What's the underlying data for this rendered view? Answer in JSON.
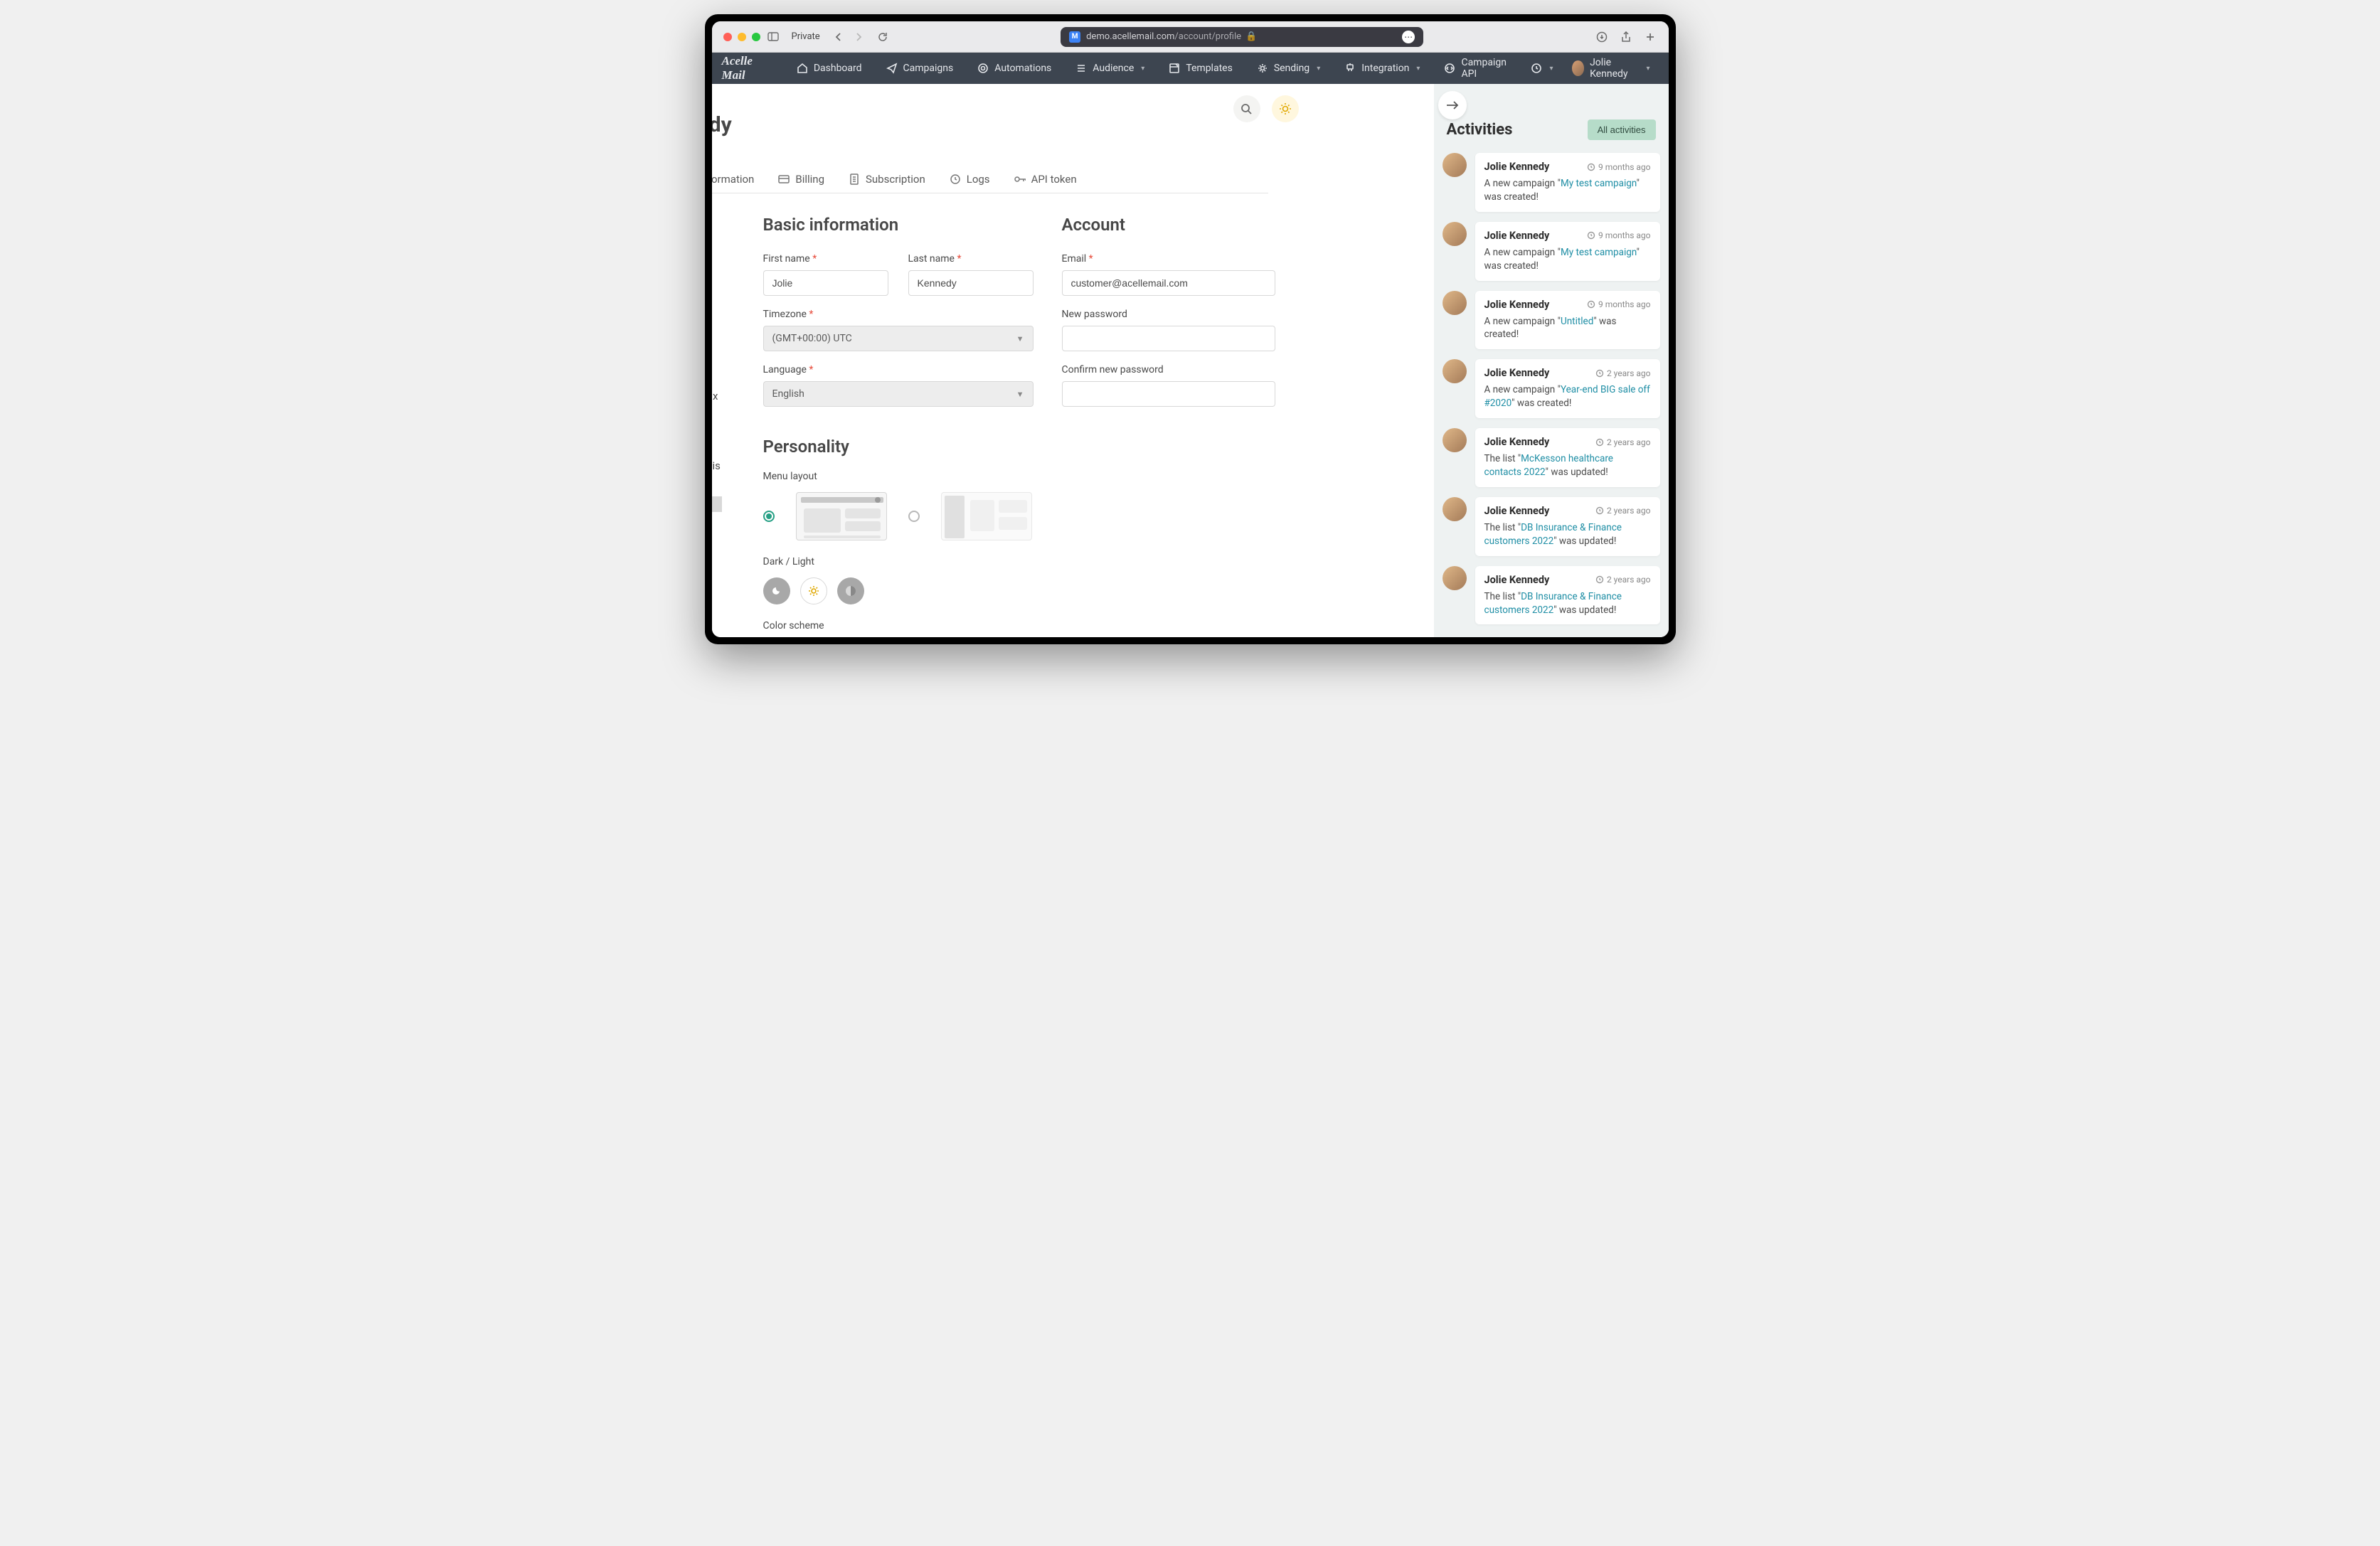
{
  "browser": {
    "private_label": "Private",
    "url_host": "demo.acellemail.com",
    "url_path": "/account/profile"
  },
  "brand": "Acelle Mail",
  "nav": {
    "dashboard": "Dashboard",
    "campaigns": "Campaigns",
    "automations": "Automations",
    "audience": "Audience",
    "templates": "Templates",
    "sending": "Sending",
    "integration": "Integration",
    "api": "Campaign API",
    "user": "Jolie Kennedy"
  },
  "page_title_fragment": "edy",
  "tabs": {
    "info": "nformation",
    "billing": "Billing",
    "subscription": "Subscription",
    "logs": "Logs",
    "apitoken": "API token"
  },
  "left_fragments": {
    "px": "px x",
    "ze": "ze is"
  },
  "sections": {
    "basic": "Basic information",
    "account": "Account",
    "personality": "Personality"
  },
  "fields": {
    "firstname_label": "First name ",
    "firstname_value": "Jolie",
    "lastname_label": "Last name ",
    "lastname_value": "Kennedy",
    "timezone_label": "Timezone ",
    "timezone_value": "(GMT+00:00) UTC",
    "language_label": "Language ",
    "language_value": "English",
    "email_label": "Email ",
    "email_value": "customer@acellemail.com",
    "newpass_label": "New password",
    "confirmpass_label": "Confirm new password",
    "menulayout_label": "Menu layout",
    "darklight_label": "Dark / Light",
    "colorscheme_label": "Color scheme",
    "required": "*"
  },
  "activities": {
    "heading": "Activities",
    "all_btn": "All activities",
    "items": [
      {
        "name": "Jolie Kennedy",
        "time": "9 months ago",
        "prefix": "A new campaign \"",
        "link": "My test campaign",
        "suffix": "\" was created!"
      },
      {
        "name": "Jolie Kennedy",
        "time": "9 months ago",
        "prefix": "A new campaign \"",
        "link": "My test campaign",
        "suffix": "\" was created!"
      },
      {
        "name": "Jolie Kennedy",
        "time": "9 months ago",
        "prefix": "A new campaign \"",
        "link": "Untitled",
        "suffix": "\" was created!"
      },
      {
        "name": "Jolie Kennedy",
        "time": "2 years ago",
        "prefix": "A new campaign \"",
        "link": "Year-end BIG sale off #2020",
        "suffix": "\" was created!"
      },
      {
        "name": "Jolie Kennedy",
        "time": "2 years ago",
        "prefix": "The list \"",
        "link": "McKesson healthcare contacts 2022",
        "suffix": "\" was updated!"
      },
      {
        "name": "Jolie Kennedy",
        "time": "2 years ago",
        "prefix": "The list \"",
        "link": "DB Insurance & Finance customers 2022",
        "suffix": "\" was updated!"
      },
      {
        "name": "Jolie Kennedy",
        "time": "2 years ago",
        "prefix": "The list \"",
        "link": "DB Insurance & Finance customers 2022",
        "suffix": "\" was updated!"
      }
    ]
  }
}
